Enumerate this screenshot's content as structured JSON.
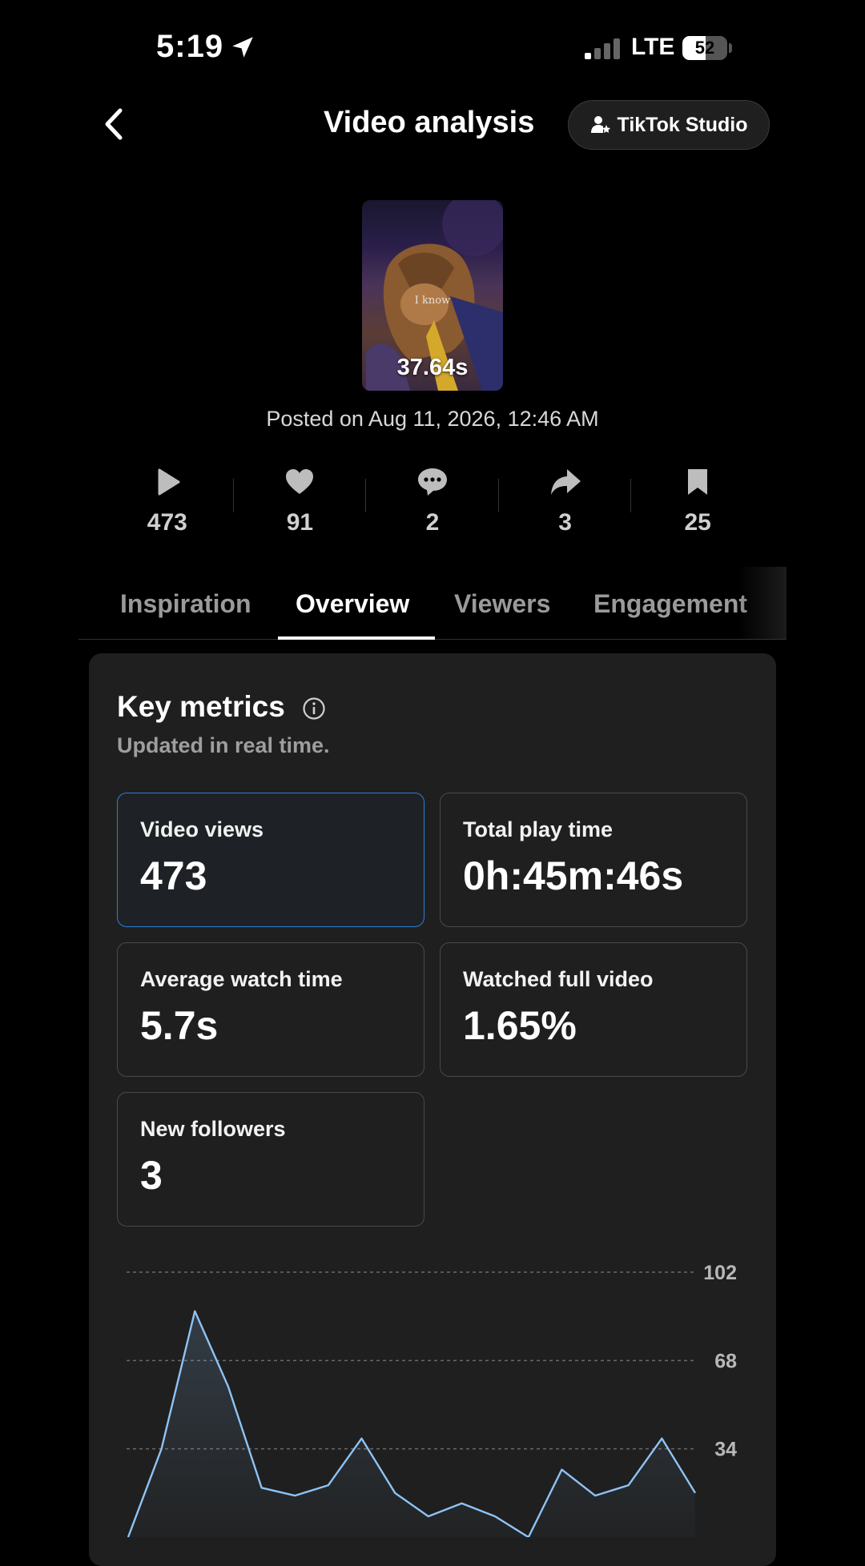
{
  "status_bar": {
    "time": "5:19",
    "network": "LTE",
    "battery": "52",
    "battery_level": 0.52
  },
  "header": {
    "back_icon": "chevron-left-icon",
    "title": "Video analysis",
    "studio_button_label": "TikTok Studio",
    "studio_icon": "person-star-icon"
  },
  "video": {
    "caption": "I know",
    "duration": "37.64s",
    "posted_on": "Posted on Aug 11, 2026, 12:46 AM"
  },
  "stats": [
    {
      "icon": "play-icon",
      "value": "473"
    },
    {
      "icon": "heart-icon",
      "value": "91"
    },
    {
      "icon": "comment-icon",
      "value": "2"
    },
    {
      "icon": "share-icon",
      "value": "3"
    },
    {
      "icon": "bookmark-icon",
      "value": "25"
    }
  ],
  "tabs": [
    {
      "label": "Inspiration",
      "active": false
    },
    {
      "label": "Overview",
      "active": true
    },
    {
      "label": "Viewers",
      "active": false
    },
    {
      "label": "Engagement",
      "active": false
    }
  ],
  "key_metrics": {
    "title": "Key metrics",
    "subtitle": "Updated in real time.",
    "items": [
      {
        "label": "Video views",
        "value": "473",
        "selected": true
      },
      {
        "label": "Total play time",
        "value": "0h:45m:46s",
        "selected": false
      },
      {
        "label": "Average watch time",
        "value": "5.7s",
        "selected": false
      },
      {
        "label": "Watched full video",
        "value": "1.65%",
        "selected": false
      },
      {
        "label": "New followers",
        "value": "3",
        "selected": false
      }
    ]
  },
  "colors": {
    "background": "#000000",
    "card": "#1f1f1f",
    "selected_border": "#2d7ed6",
    "chart_line": "#8ec3f5"
  },
  "chart_data": {
    "type": "area",
    "y_ticks": [
      "102",
      "68",
      "34"
    ],
    "ylim": [
      0,
      102
    ],
    "grid": true,
    "x": [
      1,
      2,
      3,
      4,
      5,
      6,
      7,
      8,
      9,
      10,
      11,
      12,
      13,
      14,
      15,
      16,
      17,
      18
    ],
    "series": [
      {
        "values": [
          0,
          34,
          87,
          58,
          19,
          16,
          20,
          38,
          17,
          8,
          13,
          8,
          0,
          26,
          16,
          20,
          38,
          17
        ]
      }
    ]
  }
}
